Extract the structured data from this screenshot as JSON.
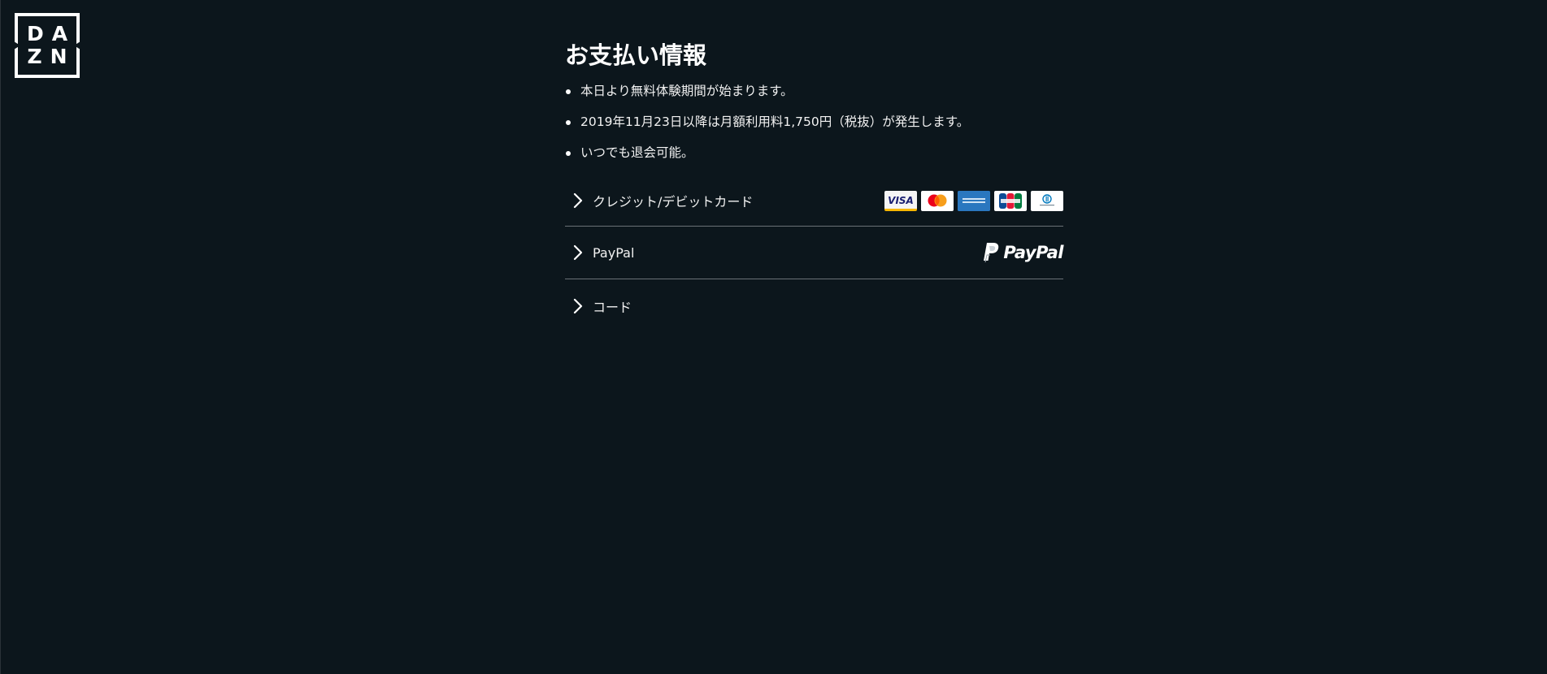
{
  "brand": {
    "logo_line1": "DA",
    "logo_line2": "ZN"
  },
  "header": {
    "title": "お支払い情報"
  },
  "notes": [
    "本日より無料体験期間が始まります。",
    "2019年11月23日以降は月額利用料1,750円（税抜）が発生します。",
    "いつでも退会可能。"
  ],
  "payment_options": [
    {
      "label": "クレジット/デビットカード",
      "icons": [
        "visa-icon",
        "mastercard-icon",
        "amex-icon",
        "jcb-icon",
        "diners-club-icon"
      ]
    },
    {
      "label": "PayPal",
      "logo_text": "PayPal",
      "icons": [
        "paypal-logo-icon"
      ]
    },
    {
      "label": "コード"
    }
  ],
  "cards": {
    "visa_text": "VISA"
  },
  "colors": {
    "background": "#0c161c",
    "text": "#f2f2f2",
    "divider": "#6a7176",
    "visa_blue": "#1a1f71",
    "amex_blue": "#2a77bf"
  }
}
